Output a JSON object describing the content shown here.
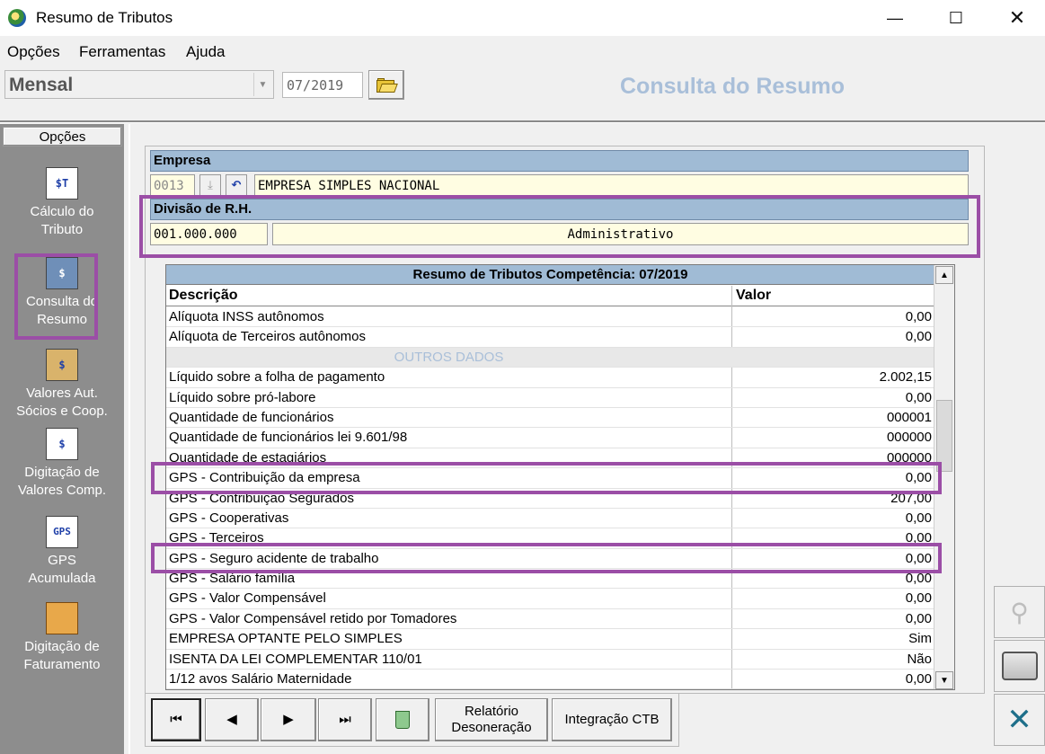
{
  "window": {
    "title": "Resumo de Tributos",
    "minimize": "—",
    "maximize": "☐",
    "close": "✕"
  },
  "menu": [
    {
      "label": "Opções"
    },
    {
      "label": "Ferramentas"
    },
    {
      "label": "Ajuda"
    }
  ],
  "toolbar": {
    "period_value": "Mensal",
    "competencia": "07/2019",
    "page_title": "Consulta do Resumo"
  },
  "sidebar": {
    "header": "Opções",
    "items": [
      {
        "label": "Cálculo do\nTributo",
        "icon": "$T"
      },
      {
        "label": "Consulta do\nResumo",
        "icon": "$"
      },
      {
        "label": "Valores Aut.\nSócios e  Coop.",
        "icon": "$"
      },
      {
        "label": "Digitação de\nValores Comp.",
        "icon": "$"
      },
      {
        "label": "GPS\nAcumulada",
        "icon": "GPS"
      },
      {
        "label": "Digitação de\nFaturamento",
        "icon": ""
      }
    ]
  },
  "empresa": {
    "label": "Empresa",
    "code": "0013",
    "name": "EMPRESA SIMPLES NACIONAL"
  },
  "divisao": {
    "label": "Divisão de R.H.",
    "code": "001.000.000",
    "name": "Administrativo"
  },
  "grid": {
    "title": "Resumo de Tributos Competência: 07/2019",
    "col_desc": "Descrição",
    "col_valor": "Valor",
    "rows": [
      {
        "d": "Alíquota INSS autônomos",
        "v": "0,00"
      },
      {
        "d": "Alíquota de Terceiros autônomos",
        "v": "0,00"
      },
      {
        "d": "OUTROS DADOS",
        "v": "",
        "section": true
      },
      {
        "d": "Líquido sobre a folha de pagamento",
        "v": "2.002,15"
      },
      {
        "d": "Líquido sobre pró-labore",
        "v": "0,00"
      },
      {
        "d": "Quantidade de funcionários",
        "v": "000001"
      },
      {
        "d": "Quantidade de funcionários lei 9.601/98",
        "v": "000000"
      },
      {
        "d": "Quantidade de estagiários",
        "v": "000000"
      },
      {
        "d": "GPS - Contribuição da empresa",
        "v": "0,00"
      },
      {
        "d": "GPS - Contribuição Segurados",
        "v": "207,00"
      },
      {
        "d": "GPS - Cooperativas",
        "v": "0,00"
      },
      {
        "d": "GPS - Terceiros",
        "v": "0,00"
      },
      {
        "d": "GPS - Seguro acidente de trabalho",
        "v": "0,00"
      },
      {
        "d": "GPS - Salário família",
        "v": "0,00"
      },
      {
        "d": "GPS - Valor Compensável",
        "v": "0,00"
      },
      {
        "d": "GPS - Valor Compensável retido por Tomadores",
        "v": "0,00"
      },
      {
        "d": "EMPRESA OPTANTE PELO SIMPLES",
        "v": "Sim"
      },
      {
        "d": "ISENTA DA LEI COMPLEMENTAR 110/01",
        "v": "Não"
      },
      {
        "d": "1/12 avos Salário Maternidade",
        "v": "0,00"
      }
    ]
  },
  "nav": {
    "first": "⏮",
    "prev": "◀",
    "next": "▶",
    "last": "⏭",
    "relatorio": "Relatório\nDesoneração",
    "integracao": "Integração CTB"
  },
  "colors": {
    "highlight": "#9b4ea6",
    "band": "#a0bbd5",
    "title_accent": "#a9bfd9"
  }
}
